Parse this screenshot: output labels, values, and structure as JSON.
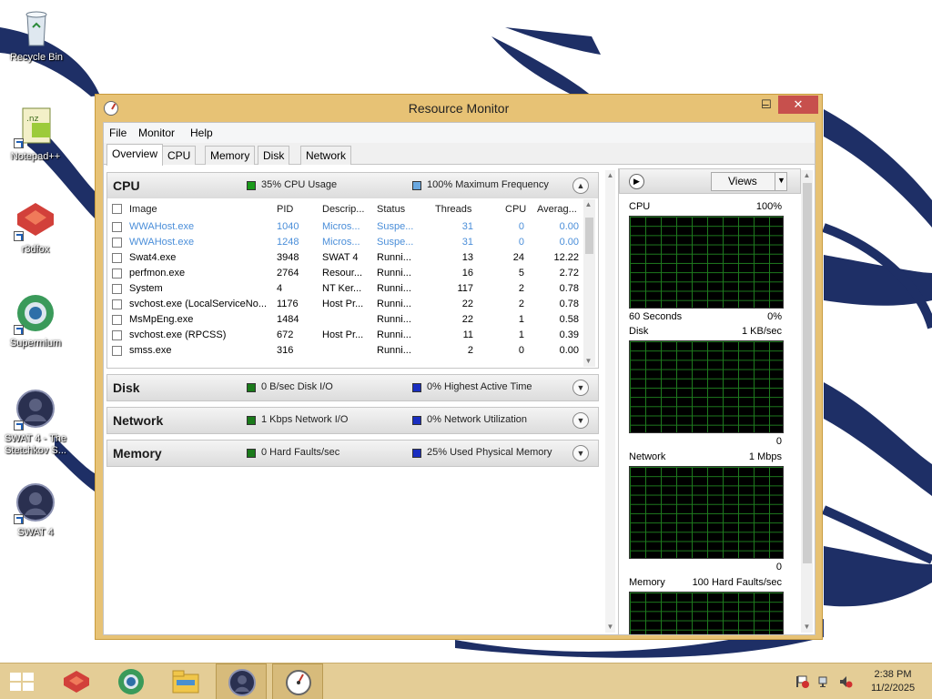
{
  "window": {
    "title": "Resource Monitor",
    "buttons": {
      "minimize": "–",
      "maximize": "☐",
      "close": "✕"
    }
  },
  "menu": [
    "File",
    "Monitor",
    "Help"
  ],
  "tabs": [
    "Overview",
    "CPU",
    "Memory",
    "Disk",
    "Network"
  ],
  "active_tab": "Overview",
  "cpu_section": {
    "title": "CPU",
    "usage": "35% CPU Usage",
    "frequency": "100% Maximum Frequency",
    "usage_color": "#1a9a1a",
    "frequency_color": "#6aa8e0",
    "columns": [
      "Image",
      "PID",
      "Descrip...",
      "Status",
      "Threads",
      "CPU",
      "Averag..."
    ],
    "processes": [
      {
        "image": "WWAHost.exe",
        "pid": "1040",
        "desc": "Micros...",
        "status": "Suspe...",
        "threads": "31",
        "cpu": "0",
        "avg": "0.00",
        "suspended": true
      },
      {
        "image": "WWAHost.exe",
        "pid": "1248",
        "desc": "Micros...",
        "status": "Suspe...",
        "threads": "31",
        "cpu": "0",
        "avg": "0.00",
        "suspended": true
      },
      {
        "image": "Swat4.exe",
        "pid": "3948",
        "desc": "SWAT 4",
        "status": "Runni...",
        "threads": "13",
        "cpu": "24",
        "avg": "12.22",
        "suspended": false
      },
      {
        "image": "perfmon.exe",
        "pid": "2764",
        "desc": "Resour...",
        "status": "Runni...",
        "threads": "16",
        "cpu": "5",
        "avg": "2.72",
        "suspended": false
      },
      {
        "image": "System",
        "pid": "4",
        "desc": "NT Ker...",
        "status": "Runni...",
        "threads": "117",
        "cpu": "2",
        "avg": "0.78",
        "suspended": false
      },
      {
        "image": "svchost.exe (LocalServiceNo...",
        "pid": "1176",
        "desc": "Host Pr...",
        "status": "Runni...",
        "threads": "22",
        "cpu": "2",
        "avg": "0.78",
        "suspended": false
      },
      {
        "image": "MsMpEng.exe",
        "pid": "1484",
        "desc": "",
        "status": "Runni...",
        "threads": "22",
        "cpu": "1",
        "avg": "0.58",
        "suspended": false
      },
      {
        "image": "svchost.exe (RPCSS)",
        "pid": "672",
        "desc": "Host Pr...",
        "status": "Runni...",
        "threads": "11",
        "cpu": "1",
        "avg": "0.39",
        "suspended": false
      },
      {
        "image": "smss.exe",
        "pid": "316",
        "desc": "",
        "status": "Runni...",
        "threads": "2",
        "cpu": "0",
        "avg": "0.00",
        "suspended": false
      }
    ]
  },
  "disk_section": {
    "title": "Disk",
    "io": "0 B/sec Disk I/O",
    "active": "0% Highest Active Time",
    "io_color": "#1a7a1a",
    "active_color": "#1a2ec0"
  },
  "network_section": {
    "title": "Network",
    "io": "1 Kbps Network I/O",
    "util": "0% Network Utilization",
    "io_color": "#1a7a1a",
    "util_color": "#1a2ec0"
  },
  "memory_section": {
    "title": "Memory",
    "faults": "0 Hard Faults/sec",
    "used": "25% Used Physical Memory",
    "faults_color": "#1a7a1a",
    "used_color": "#1a2ec0"
  },
  "graphs": {
    "views_label": "Views",
    "cpu": {
      "name": "CPU",
      "max": "100%",
      "time": "60 Seconds",
      "min": "0%"
    },
    "disk": {
      "name": "Disk",
      "max": "1 KB/sec",
      "min": "0"
    },
    "network": {
      "name": "Network",
      "max": "1 Mbps",
      "min": "0"
    },
    "memory": {
      "name": "Memory",
      "max": "100 Hard Faults/sec"
    }
  },
  "desktop_icons": [
    {
      "label": "Recycle Bin",
      "icon": "recycle-bin-icon"
    },
    {
      "label": "Notepad++",
      "icon": "notepad-plus-plus-icon"
    },
    {
      "label": "r3dfox",
      "icon": "r3dfox-icon"
    },
    {
      "label": "Supermium",
      "icon": "supermium-icon"
    },
    {
      "label": "SWAT 4 - The Stetchkov S...",
      "icon": "swat4-expansion-icon"
    },
    {
      "label": "SWAT 4",
      "icon": "swat4-icon"
    }
  ],
  "taskbar": {
    "pinned": [
      "r3dfox-icon",
      "supermium-icon",
      "file-explorer-icon",
      "swat4-icon",
      "resource-monitor-icon"
    ],
    "clock_time": "2:38 PM",
    "clock_date": "11/2/2025",
    "color": "#e4cd96"
  }
}
